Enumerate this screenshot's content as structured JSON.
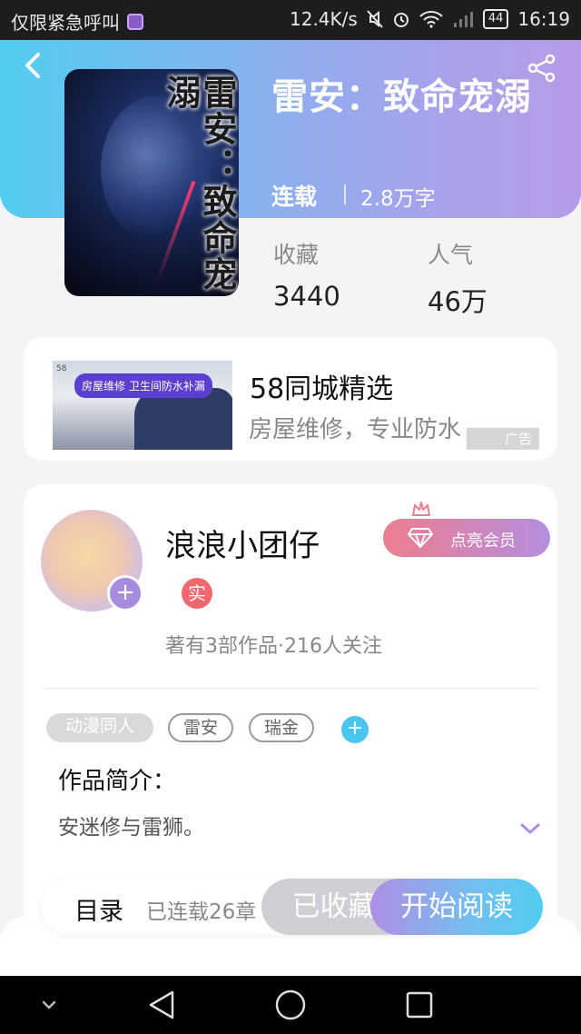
{
  "status_bar": {
    "carrier": "仅限紧急呼叫",
    "speed": "12.4K/s",
    "battery": "44",
    "time": "16:19"
  },
  "book": {
    "cover_title": "雷安：致命宠溺",
    "title": "雷安：致命宠溺",
    "status": "连载",
    "word_count": "2.8万字",
    "stats": {
      "favorites_label": "收藏",
      "favorites_value": "3440",
      "popularity_label": "人气",
      "popularity_value": "46万"
    }
  },
  "ad": {
    "image_tag": "房屋维修 卫生间防水补漏",
    "image_logo": "58",
    "title": "58同城精选",
    "description": "房屋维修，专业防水",
    "badge": "广告"
  },
  "author": {
    "name": "浪浪小团仔",
    "verified_badge": "实",
    "vip_button": "点亮会员",
    "stats": "著有3部作品·216人关注",
    "plus": "+"
  },
  "tags": [
    "动漫同人",
    "雷安",
    "瑞金"
  ],
  "tag_add": "+",
  "intro": {
    "heading": "作品简介：",
    "text": "安迷修与雷狮。"
  },
  "action_bar": {
    "toc_label": "目录",
    "toc_status": "已连载26章",
    "collected_button": "已收藏",
    "read_button": "开始阅读"
  },
  "colors": {
    "header_gradient_start": "#52cdf0",
    "header_gradient_end": "#b89be8",
    "accent_red": "#f0686d",
    "accent_blue": "#49c6ee"
  }
}
